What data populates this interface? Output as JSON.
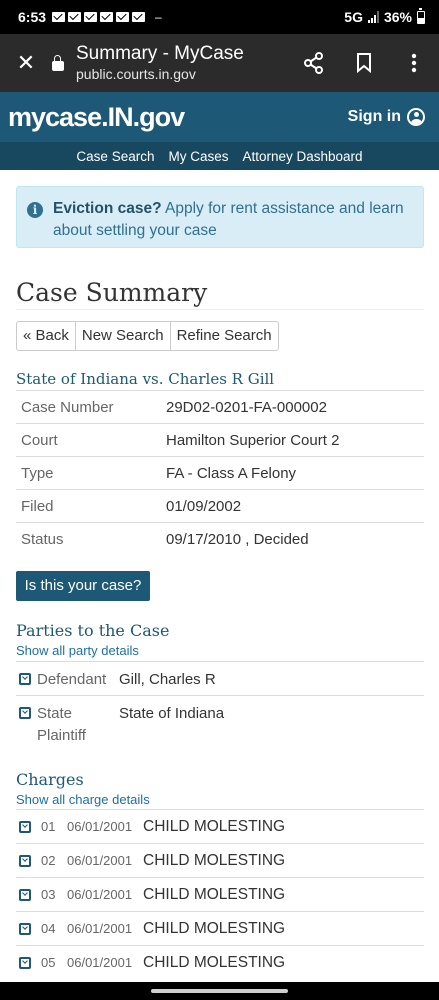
{
  "status_bar": {
    "time": "6:53",
    "notifications": [
      "mail-icon",
      "mail-icon",
      "mail-icon",
      "mail-icon",
      "mail-icon",
      "mail-icon"
    ],
    "extra": "–",
    "network": "5G",
    "battery": "36%"
  },
  "browser": {
    "page_title": "Summary - MyCase",
    "url": "public.courts.in.gov"
  },
  "site": {
    "logo": "mycase.IN.gov",
    "sign_in": "Sign in",
    "nav": [
      "Case Search",
      "My Cases",
      "Attorney Dashboard"
    ]
  },
  "alert": {
    "bold": "Eviction case?",
    "text": " Apply for rent assistance and learn about settling your case"
  },
  "page": {
    "title": "Case Summary",
    "buttons": {
      "back": "« Back",
      "new_search": "New Search",
      "refine_search": "Refine Search"
    }
  },
  "case": {
    "title": "State of Indiana vs. Charles R Gill",
    "rows": [
      {
        "label": "Case Number",
        "value": "29D02-0201-FA-000002"
      },
      {
        "label": "Court",
        "value": "Hamilton Superior Court 2"
      },
      {
        "label": "Type",
        "value": "FA - Class A Felony"
      },
      {
        "label": "Filed",
        "value": "01/09/2002"
      },
      {
        "label": "Status",
        "value": "09/17/2010 , Decided"
      }
    ],
    "your_case_button": "Is this your case?"
  },
  "parties": {
    "title": "Parties to the Case",
    "link": "Show all party details",
    "rows": [
      {
        "label": "Defendant",
        "value": "Gill, Charles R"
      },
      {
        "label": "State Plaintiff",
        "value": "State of Indiana"
      }
    ]
  },
  "charges": {
    "title": "Charges",
    "link": "Show all charge details",
    "rows": [
      {
        "num": "01",
        "date": "06/01/2001",
        "desc": "CHILD MOLESTING"
      },
      {
        "num": "02",
        "date": "06/01/2001",
        "desc": "CHILD MOLESTING"
      },
      {
        "num": "03",
        "date": "06/01/2001",
        "desc": "CHILD MOLESTING"
      },
      {
        "num": "04",
        "date": "06/01/2001",
        "desc": "CHILD MOLESTING"
      },
      {
        "num": "05",
        "date": "06/01/2001",
        "desc": "CHILD MOLESTING"
      }
    ]
  },
  "colors": {
    "brand": "#1d5876",
    "brand_dark": "#174860",
    "alert_bg": "#d9edf7",
    "alert_text": "#31708f"
  }
}
